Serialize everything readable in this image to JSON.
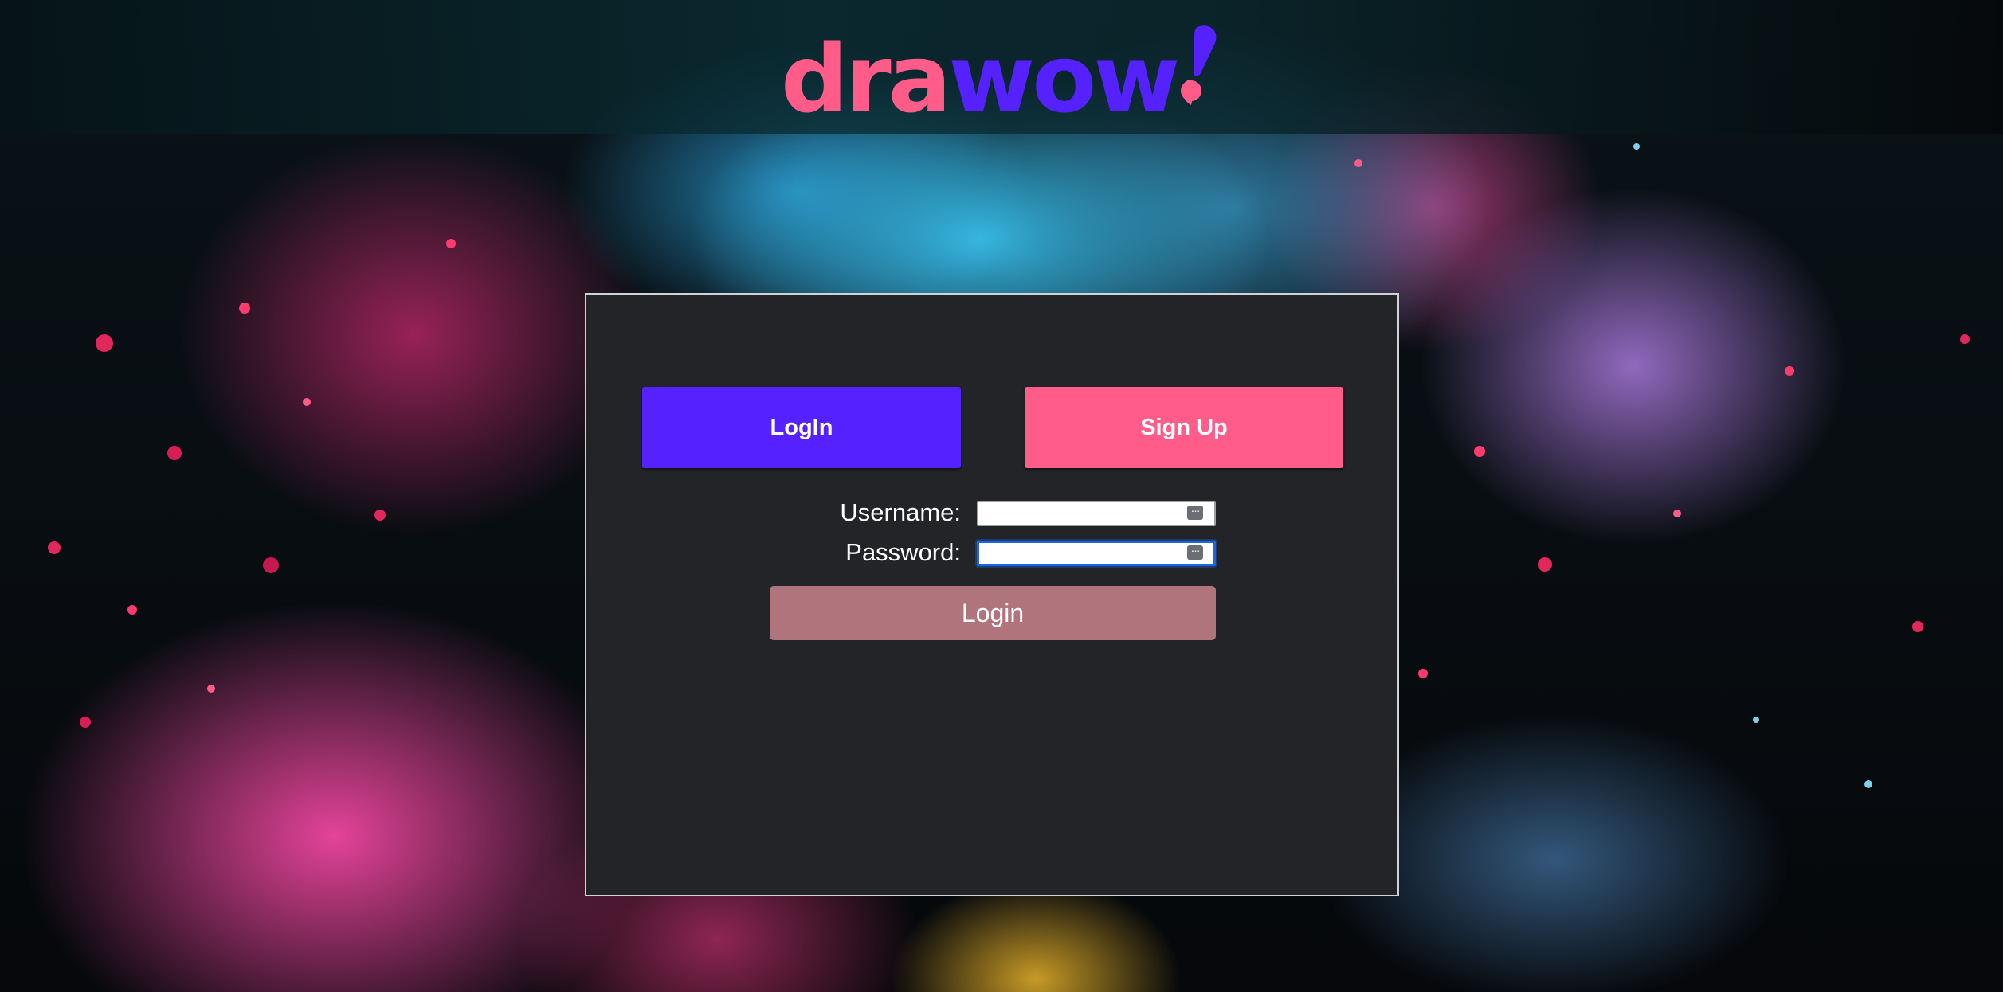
{
  "app": {
    "logo": {
      "part_pink": "dra",
      "part_blue": "wow"
    }
  },
  "tabs": {
    "login_label": "LogIn",
    "signup_label": "Sign Up"
  },
  "form": {
    "username_label": "Username:",
    "username_value": "",
    "password_label": "Password:",
    "password_value": "",
    "submit_label": "Login"
  },
  "colors": {
    "brand_pink": "#ff5c8a",
    "brand_blue": "#5522ff",
    "panel_bg": "#222428",
    "submit_bg": "#b0747c"
  },
  "icons": {
    "password_manager": "password-manager-key-icon",
    "logo_mark": "exclamation-mark-icon"
  }
}
